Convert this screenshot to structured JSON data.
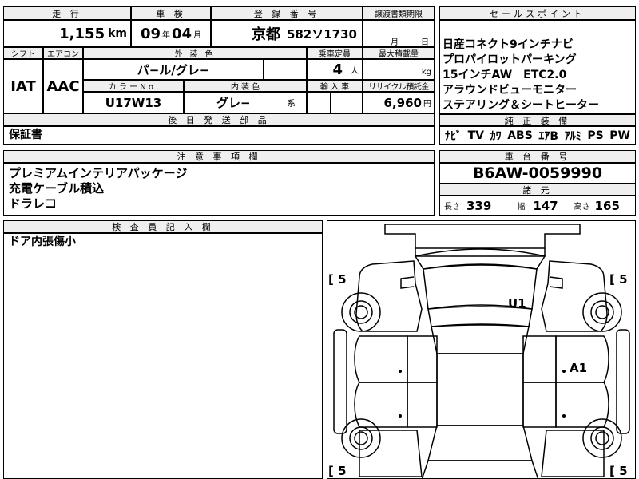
{
  "top": {
    "mileage_label": "走 行",
    "shaken_label": "車 検",
    "reg_label": "登 録 番 号",
    "transfer_label": "譲渡書類期限",
    "mileage_value": "1,155",
    "mileage_unit": "km",
    "shaken_year": "09",
    "year_unit": "年",
    "shaken_month": "04",
    "month_unit": "月",
    "reg_area": "京都",
    "reg_number": "582ソ1730",
    "transfer_month": "月",
    "transfer_day": "日"
  },
  "sales": {
    "header": "セールスポイント",
    "lines": [
      "日産コネクト9インチナビ",
      "プロパイロットパーキング",
      "15インチAW　ETC2.0",
      "アラウンドビューモニター",
      "ステアリング＆シートヒーター"
    ]
  },
  "spec": {
    "shift_label": "シフト",
    "ac_label": "エアコン",
    "ext_color_label": "外 装 色",
    "capacity_label": "乗車定員",
    "max_load_label": "最大積載量",
    "shift_value": "IAT",
    "ac_value": "AAC",
    "ext_color_value": "パ−ル/グレ−",
    "capacity_value": "4",
    "capacity_unit": "人",
    "load_unit": "kg",
    "color_no_label": "カ ラ ー N o .",
    "int_color_label": "内 装 色",
    "import_label": "輸 入 車",
    "recycle_label": "リサイクル預託金",
    "color_no_value": "U17W13",
    "int_color_value": "グレ−",
    "int_color_suffix": "系",
    "recycle_value": "6,960",
    "recycle_unit": "円"
  },
  "genuine": {
    "header": "純 正 装 備",
    "items": [
      "ﾅﾋﾞ",
      "TV",
      "ｶﾜ",
      "ABS",
      "ｴｱB",
      "ｱﾙﾐ",
      "PS",
      "PW"
    ]
  },
  "later_parts": {
    "header": "後 日 発 送 部 品",
    "value": "保証書"
  },
  "notes": {
    "header": "注 意 事 項 欄",
    "lines": [
      "プレミアムインテリアパッケージ",
      "充電ケーブル積込",
      "ドラレコ"
    ]
  },
  "chassis": {
    "header": "車 台 番 号",
    "value": "B6AW-0059990"
  },
  "dims": {
    "header": "諸 元",
    "length_label": "長さ",
    "length_value": "339",
    "width_label": "幅",
    "width_value": "147",
    "height_label": "高さ",
    "height_value": "165"
  },
  "inspector": {
    "header": "検 査 員 記 入 欄",
    "value": "ドア内張傷小"
  },
  "diagram": {
    "tire_fl": "[ 5",
    "tire_fr": "[ 5",
    "tire_rl": "[ 5",
    "tire_rr": "[ 5",
    "mark_u1": "U1",
    "mark_a1": "A1"
  }
}
